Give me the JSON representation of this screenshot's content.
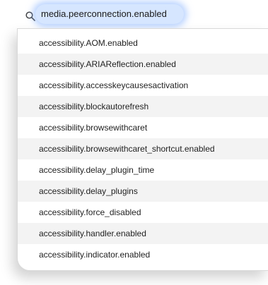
{
  "search": {
    "value": "media.peerconnection.enabled",
    "icon": "search-icon"
  },
  "results": [
    "accessibility.AOM.enabled",
    "accessibility.ARIAReflection.enabled",
    "accessibility.accesskeycausesactivation",
    "accessibility.blockautorefresh",
    "accessibility.browsewithcaret",
    "accessibility.browsewithcaret_shortcut.enabled",
    "accessibility.delay_plugin_time",
    "accessibility.delay_plugins",
    "accessibility.force_disabled",
    "accessibility.handler.enabled",
    "accessibility.indicator.enabled"
  ],
  "colors": {
    "highlight": "#d6e6ff",
    "alt_row": "#f3f3f3"
  }
}
